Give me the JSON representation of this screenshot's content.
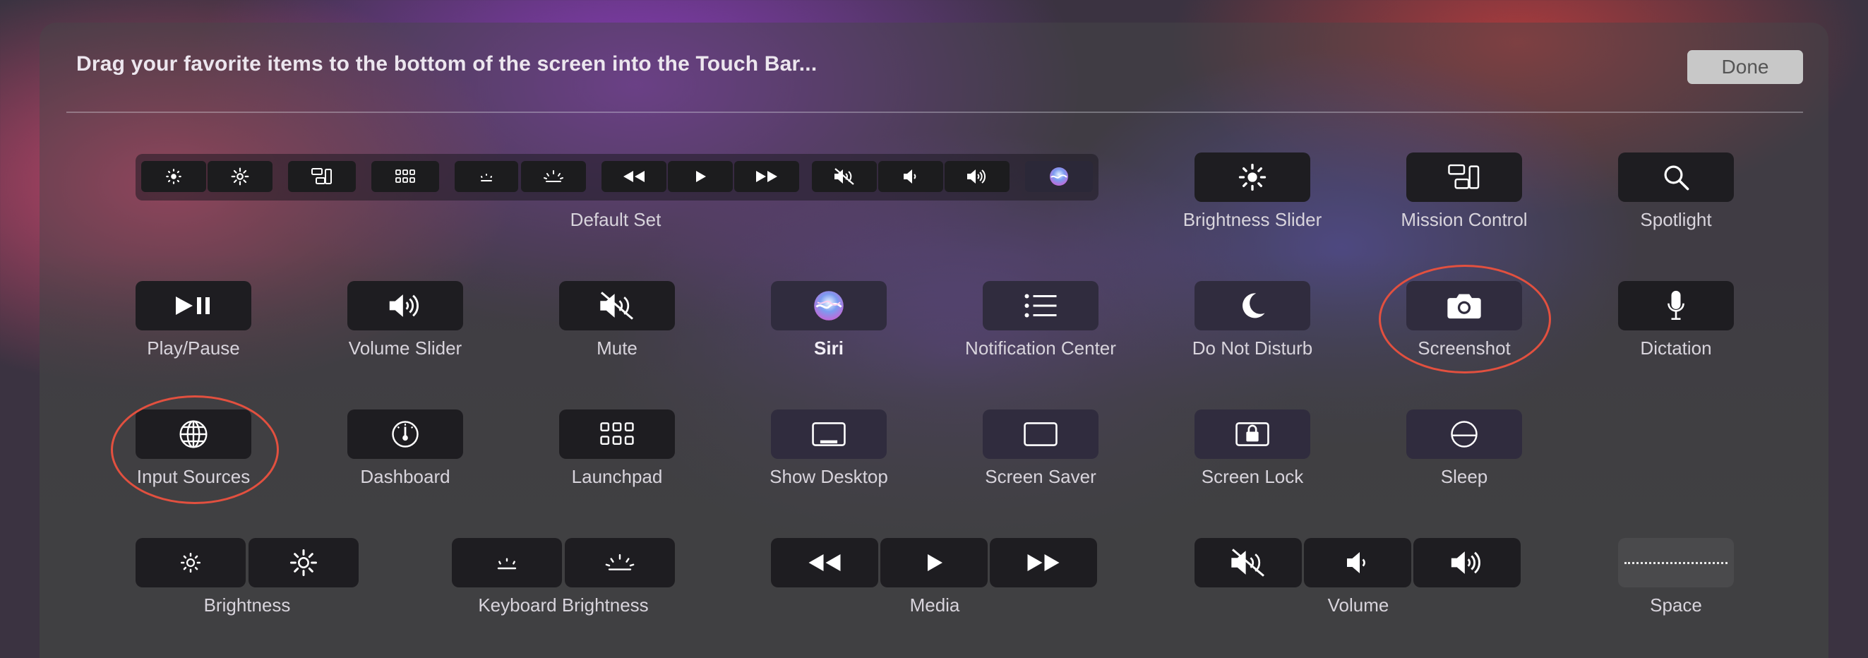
{
  "header": {
    "instruction": "Drag your favorite items to the bottom of the screen into the Touch Bar...",
    "done_label": "Done"
  },
  "default_set": {
    "label": "Default Set",
    "items": [
      "brightness-down-icon",
      "brightness-up-icon",
      "mission-control-icon",
      "launchpad-icon",
      "keyboard-brightness-down-icon",
      "keyboard-brightness-up-icon",
      "rewind-icon",
      "play-icon",
      "fast-forward-icon",
      "mute-icon",
      "volume-down-icon",
      "volume-up-icon",
      "siri-icon"
    ]
  },
  "items": {
    "brightness_slider": "Brightness Slider",
    "mission_control": "Mission Control",
    "spotlight": "Spotlight",
    "play_pause": "Play/Pause",
    "volume_slider": "Volume Slider",
    "mute": "Mute",
    "siri": "Siri",
    "notification_center": "Notification Center",
    "do_not_disturb": "Do Not Disturb",
    "screenshot": "Screenshot",
    "dictation": "Dictation",
    "input_sources": "Input Sources",
    "dashboard": "Dashboard",
    "launchpad": "Launchpad",
    "show_desktop": "Show Desktop",
    "screen_saver": "Screen Saver",
    "screen_lock": "Screen Lock",
    "sleep": "Sleep",
    "brightness": "Brightness",
    "keyboard_brightness": "Keyboard Brightness",
    "media": "Media",
    "volume": "Volume",
    "space": "Space"
  },
  "colors": {
    "highlight_ring": "#e2503f",
    "done_button": "#c8c8c8",
    "key_background": "#1e1d21"
  }
}
